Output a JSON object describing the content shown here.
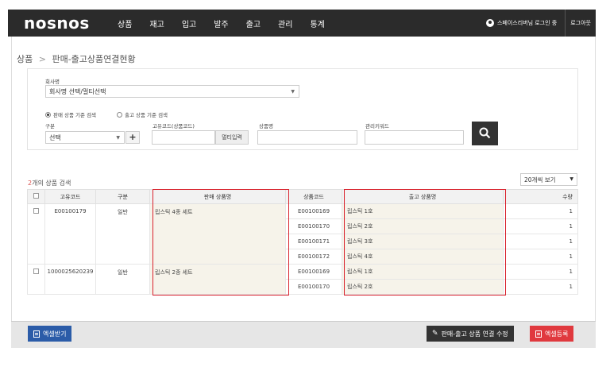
{
  "header": {
    "logo": "nosnos",
    "nav": [
      "상품",
      "재고",
      "입고",
      "발주",
      "출고",
      "관리",
      "통계"
    ],
    "user_text": "스페이스리버님 로그인 중",
    "logout_label": "로그아웃"
  },
  "breadcrumb": {
    "root": "상품",
    "separator": ">",
    "current": "판매-출고상품연결현황"
  },
  "filters": {
    "company_label": "회사명",
    "company_value": "회사명 선택/멀티선택",
    "radio_sales_label": "판매 상품 기준 검색",
    "radio_outbound_label": "출고 상품 기준 검색",
    "division_label": "구분",
    "division_value": "선택",
    "unique_code_label": "고유코드(상품코드)",
    "multi_input_label": "멀티입력",
    "product_name_label": "상품명",
    "management_keyword_label": "관리키워드",
    "unique_code_value": "",
    "product_name_value": "",
    "management_keyword_value": ""
  },
  "results": {
    "count": "2",
    "count_suffix": "개의 상품 검색",
    "per_page": "20개씩 보기"
  },
  "table": {
    "headers": [
      "고유코드",
      "구분",
      "판매 상품명",
      "상품코드",
      "출고 상품명",
      "수량"
    ],
    "groups": [
      {
        "code": "E00100179",
        "type": "일반",
        "sales_name": "립스틱 4종 세트",
        "items": [
          {
            "product_code": "E00100169",
            "out_name": "립스틱 1호",
            "qty": "1"
          },
          {
            "product_code": "E00100170",
            "out_name": "립스틱 2호",
            "qty": "1"
          },
          {
            "product_code": "E00100171",
            "out_name": "립스틱 3호",
            "qty": "1"
          },
          {
            "product_code": "E00100172",
            "out_name": "립스틱 4호",
            "qty": "1"
          }
        ]
      },
      {
        "code": "1000025620239",
        "type": "일반",
        "sales_name": "립스틱 2종 세트",
        "items": [
          {
            "product_code": "E00100169",
            "out_name": "립스틱 1호",
            "qty": "1"
          },
          {
            "product_code": "E00100170",
            "out_name": "립스틱 2호",
            "qty": "1"
          }
        ]
      }
    ]
  },
  "footer": {
    "excel_download_label": "엑셀받기",
    "edit_link_label": "판매-출고 상품 연결 수정",
    "excel_register_label": "엑셀등록"
  },
  "colors": {
    "topbar": "#2b2b2b",
    "highlight": "#d9232e",
    "excel_download": "#2b5ca8",
    "excel_register": "#e0393e"
  }
}
